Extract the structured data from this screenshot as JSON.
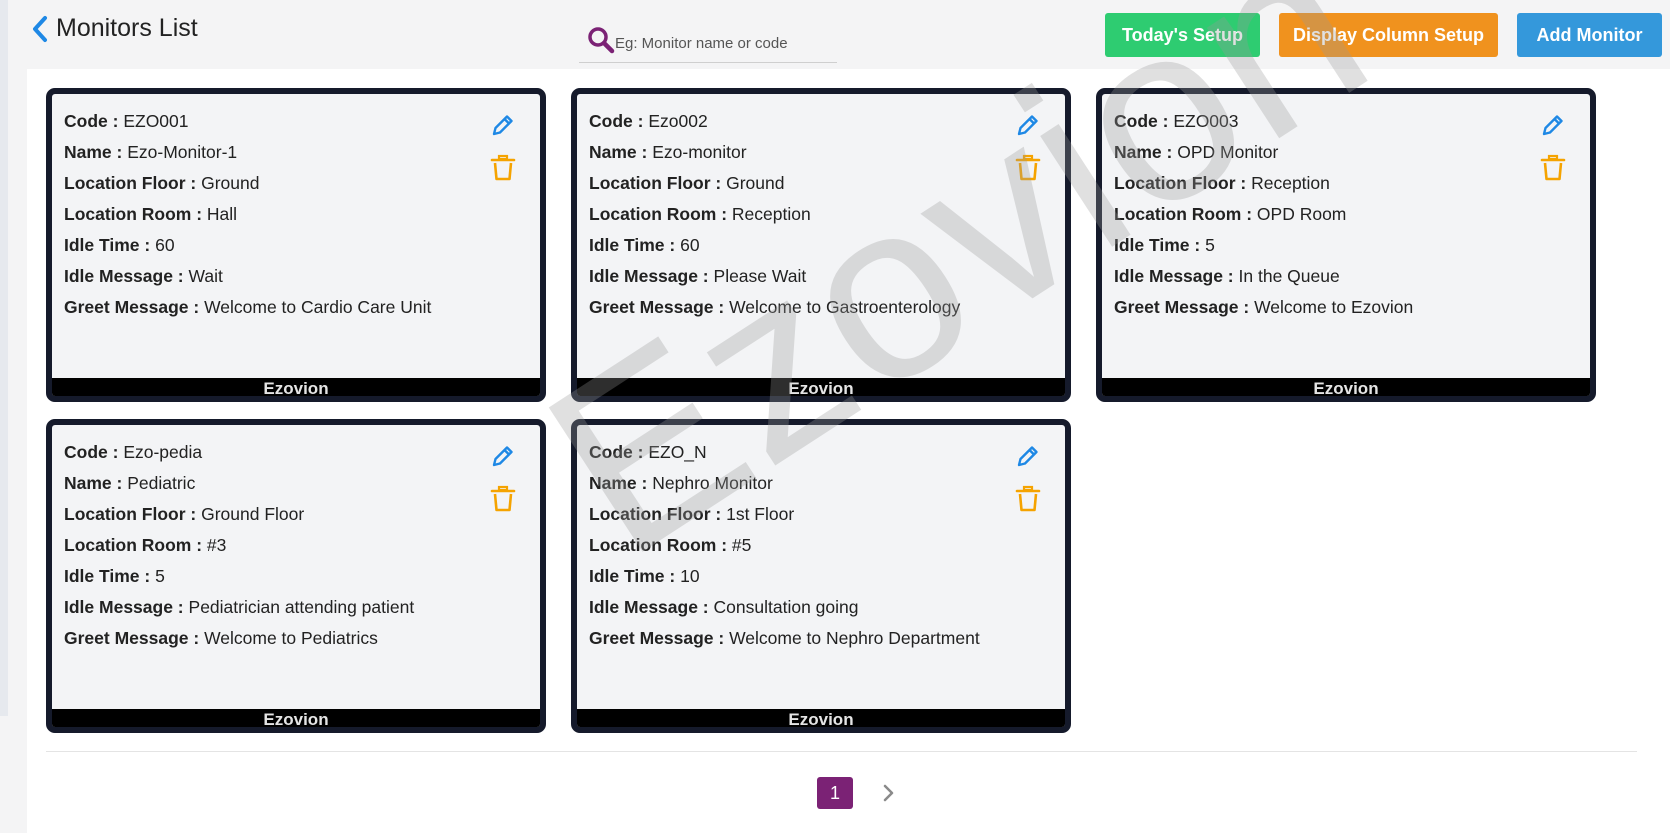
{
  "header": {
    "title": "Monitors List",
    "search_placeholder": "Eg: Monitor name or code",
    "buttons": {
      "todays_setup": "Today's Setup",
      "display_column_setup": "Display Column Setup",
      "add_monitor": "Add Monitor"
    }
  },
  "colors": {
    "today_button": "#2ecc71",
    "display_button": "#f0921e",
    "add_button": "#3498db",
    "edit_icon": "#1e88e5",
    "delete_icon": "#f5a300",
    "pagination_active": "#7b2275",
    "card_border": "#151a2b"
  },
  "labels": {
    "code": "Code :",
    "name": "Name :",
    "floor": "Location Floor :",
    "room": "Location Room :",
    "idle_time": "Idle Time :",
    "idle_message": "Idle Message :",
    "greet_message": "Greet Message :"
  },
  "monitors": [
    {
      "code": "EZO001",
      "name": "Ezo-Monitor-1",
      "floor": "Ground",
      "room": "Hall",
      "idle_time": "60",
      "idle_message": "Wait",
      "greet_message": "Welcome to Cardio Care Unit",
      "footer": "Ezovion"
    },
    {
      "code": "Ezo002",
      "name": "Ezo-monitor",
      "floor": "Ground",
      "room": "Reception",
      "idle_time": "60",
      "idle_message": "Please Wait",
      "greet_message": "Welcome to Gastroenterology",
      "footer": "Ezovion"
    },
    {
      "code": "EZO003",
      "name": "OPD Monitor",
      "floor": "Reception",
      "room": "OPD Room",
      "idle_time": "5",
      "idle_message": "In the Queue",
      "greet_message": "Welcome to Ezovion",
      "footer": "Ezovion"
    },
    {
      "code": "Ezo-pedia",
      "name": "Pediatric",
      "floor": "Ground Floor",
      "room": "#3",
      "idle_time": "5",
      "idle_message": "Pediatrician attending patient",
      "greet_message": "Welcome to Pediatrics",
      "footer": "Ezovion"
    },
    {
      "code": "EZO_N",
      "name": "Nephro Monitor",
      "floor": "1st Floor",
      "room": "#5",
      "idle_time": "10",
      "idle_message": "Consultation going",
      "greet_message": "Welcome to Nephro Department",
      "footer": "Ezovion"
    }
  ],
  "watermark": "Ezovion",
  "pagination": {
    "current": "1"
  }
}
